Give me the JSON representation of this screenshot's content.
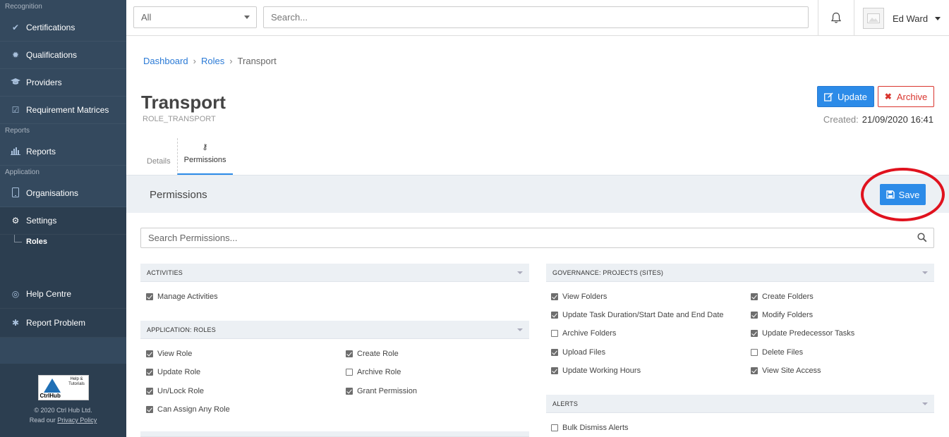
{
  "sidebar": {
    "sections": [
      {
        "label": "Recognition"
      },
      {
        "label": "Reports"
      },
      {
        "label": "Application"
      }
    ],
    "items": [
      {
        "label": "Certifications",
        "icon": "check-icon"
      },
      {
        "label": "Qualifications",
        "icon": "badge-icon"
      },
      {
        "label": "Providers",
        "icon": "graduation-cap-icon"
      },
      {
        "label": "Requirement Matrices",
        "icon": "checkbox-icon"
      },
      {
        "label": "Reports",
        "icon": "bar-chart-icon"
      },
      {
        "label": "Organisations",
        "icon": "tablet-icon"
      },
      {
        "label": "Settings",
        "icon": "gear-icon"
      },
      {
        "label": "Help Centre",
        "icon": "lifebuoy-icon"
      },
      {
        "label": "Report Problem",
        "icon": "bug-icon"
      }
    ],
    "sub_item": "Roles",
    "logo": {
      "name": "CtrlHub",
      "help": "Help & Tutorials"
    },
    "copyright": "© 2020 Ctrl Hub Ltd.",
    "privacy_prefix": "Read our",
    "privacy_link": "Privacy Policy"
  },
  "topbar": {
    "filter_value": "All",
    "search_placeholder": "Search...",
    "user_name": "Ed Ward"
  },
  "breadcrumb": {
    "items": [
      "Dashboard",
      "Roles",
      "Transport"
    ]
  },
  "page": {
    "title": "Transport",
    "code": "ROLE_TRANSPORT",
    "update_label": "Update",
    "archive_label": "Archive",
    "created_label": "Created:",
    "created_value": "21/09/2020 16:41"
  },
  "tabs": [
    {
      "label": "Details"
    },
    {
      "label": "Permissions"
    }
  ],
  "permissions": {
    "heading": "Permissions",
    "save_label": "Save",
    "search_placeholder": "Search Permissions...",
    "groups": [
      {
        "title": "ACTIVITIES",
        "items": [
          {
            "label": "Manage Activities",
            "checked": true
          }
        ]
      },
      {
        "title": "APPLICATION: ROLES",
        "items": [
          {
            "label": "View Role",
            "checked": true
          },
          {
            "label": "Create Role",
            "checked": true
          },
          {
            "label": "Update Role",
            "checked": true
          },
          {
            "label": "Archive Role",
            "checked": false
          },
          {
            "label": "Un/Lock Role",
            "checked": true
          },
          {
            "label": "Grant Permission",
            "checked": true
          },
          {
            "label": "Can Assign Any Role",
            "checked": true
          }
        ]
      },
      {
        "title": "GOVERNANCE: PROJECTS (SITES)",
        "items": [
          {
            "label": "View Folders",
            "checked": true
          },
          {
            "label": "Create Folders",
            "checked": true
          },
          {
            "label": "Update Task Duration/Start Date and End Date",
            "checked": true
          },
          {
            "label": "Modify Folders",
            "checked": true
          },
          {
            "label": "Archive Folders",
            "checked": false
          },
          {
            "label": "Update Predecessor Tasks",
            "checked": true
          },
          {
            "label": "Upload Files",
            "checked": true
          },
          {
            "label": "Delete Files",
            "checked": false
          },
          {
            "label": "Update Working Hours",
            "checked": true
          },
          {
            "label": "View Site Access",
            "checked": true
          }
        ]
      },
      {
        "title": "ALERTS",
        "items": [
          {
            "label": "Bulk Dismiss Alerts",
            "checked": false
          }
        ]
      }
    ]
  },
  "colors": {
    "sidebar": "#34495e",
    "primary": "#2c8be8",
    "danger": "#d9352e",
    "annotation": "#e0121e"
  }
}
